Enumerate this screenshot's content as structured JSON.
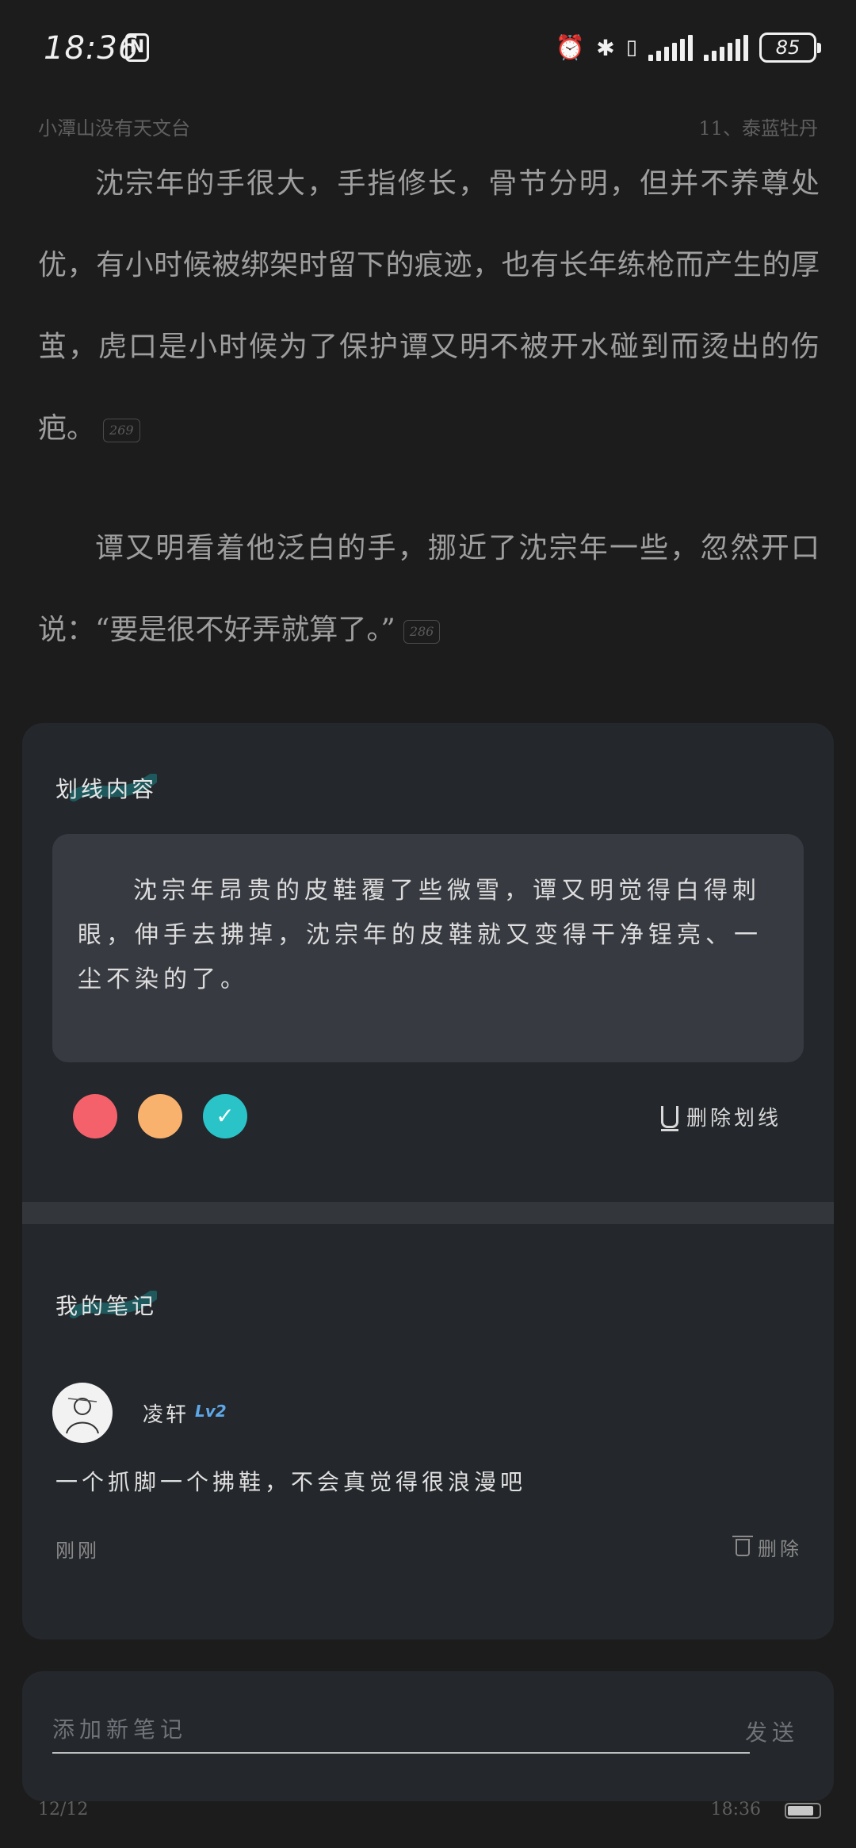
{
  "status_bar": {
    "time": "18:36",
    "battery_level": "85",
    "icons": [
      "nfc-icon",
      "alarm-icon",
      "bluetooth-icon",
      "vibrate-icon",
      "signal-icon",
      "signal-icon",
      "battery-icon"
    ]
  },
  "reader": {
    "book_name": "小潭山没有天文台",
    "chapter": "11、泰蓝牡丹",
    "paragraphs": [
      {
        "text": "沈宗年的手很大，手指修长，骨节分明，但并不养尊处优，有小时候被绑架时留下的痕迹，也有长年练枪而产生的厚茧，虎口是小时候为了保护谭又明不被开水碰到而烫出的伤疤。",
        "comment_count": "269"
      },
      {
        "text": "谭又明看着他泛白的手，挪近了沈宗年一些，忽然开口说：“要是很不好弄就算了。”",
        "comment_count": "286"
      }
    ]
  },
  "highlight": {
    "title": "划线内容",
    "quote": "沈宗年昂贵的皮鞋覆了些微雪，谭又明觉得白得刺眼，伸手去拂掉，沈宗年的皮鞋就又变得干净锃亮、一尘不染的了。",
    "colors": [
      "#f4616b",
      "#f9b16e",
      "#2ac4c8"
    ],
    "selected_color": "#2ac4c8",
    "delete_label": "删除划线"
  },
  "notes": {
    "title": "我的笔记",
    "items": [
      {
        "user": "凌轩",
        "level": "Lv2",
        "text": "一个抓脚一个拂鞋，不会真觉得很浪漫吧",
        "time": "刚刚",
        "delete_label": "删除"
      }
    ]
  },
  "composer": {
    "placeholder": "添加新笔记",
    "send_label": "发送"
  },
  "footer": {
    "page": "12/12",
    "time": "18:36"
  }
}
